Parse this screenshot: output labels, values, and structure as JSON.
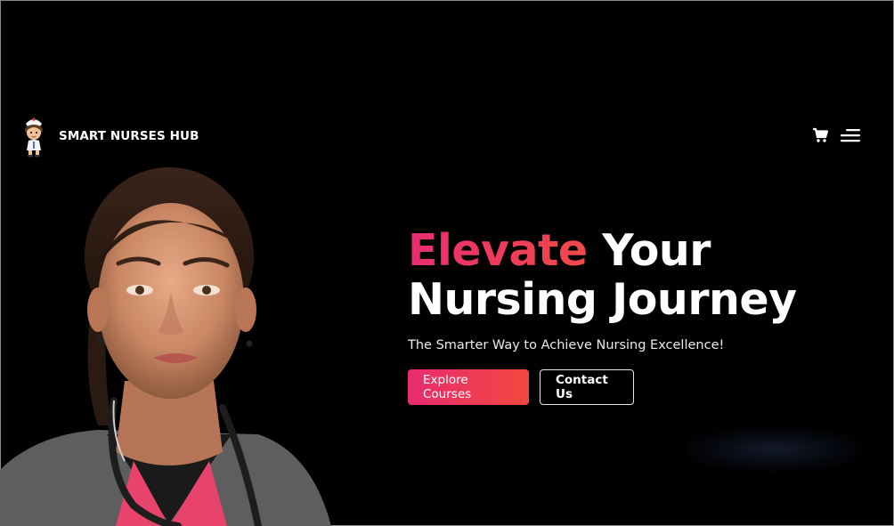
{
  "brand": {
    "name": "SMART NURSES HUB",
    "logo_icon": "nurse-mascot-icon"
  },
  "nav": {
    "cart_icon": "cart-icon",
    "menu_icon": "hamburger-menu-icon"
  },
  "hero": {
    "headline_accent": "Elevate",
    "headline_rest": " Your",
    "headline_line2": "Nursing Journey",
    "tagline": "The Smarter Way to Achieve Nursing Excellence!",
    "primary_cta": "Explore Courses",
    "secondary_cta": "Contact Us"
  },
  "colors": {
    "accent_start": "#ea2c73",
    "accent_end": "#f04a47",
    "background": "#000000"
  }
}
